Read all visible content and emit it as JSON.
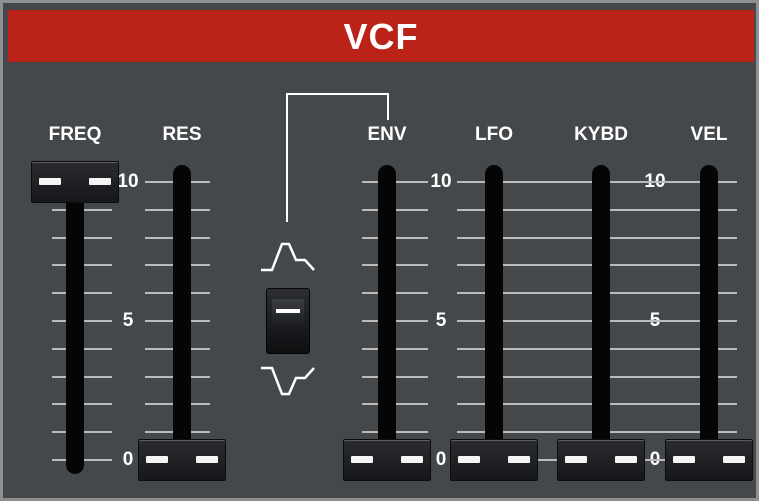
{
  "panel": {
    "title": "VCF"
  },
  "sliders": {
    "freq": {
      "label": "FREQ",
      "value": 1.0
    },
    "res": {
      "label": "RES",
      "value": 0.0
    },
    "env": {
      "label": "ENV",
      "value": 0.0
    },
    "lfo": {
      "label": "LFO",
      "value": 0.0
    },
    "kybd": {
      "label": "KYBD",
      "value": 0.0
    },
    "vel": {
      "label": "VEL",
      "value": 0.0
    }
  },
  "scale": {
    "max": "10",
    "mid": "5",
    "min": "0"
  },
  "env_polarity": {
    "value": "positive",
    "icon_top": "positive-envelope-icon",
    "icon_bottom": "inverted-envelope-icon"
  },
  "colors": {
    "header": "#bb2318",
    "panel": "#45484b",
    "text": "#ffffff"
  }
}
